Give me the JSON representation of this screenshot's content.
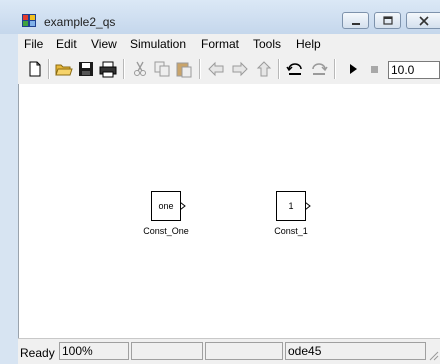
{
  "window": {
    "title": "example2_qs"
  },
  "menu": [
    "File",
    "Edit",
    "View",
    "Simulation",
    "Format",
    "Tools",
    "Help"
  ],
  "toolbar": {
    "stop_time": "10.0"
  },
  "blocks": [
    {
      "text": "one",
      "label": "Const_One"
    },
    {
      "text": "1",
      "label": "Const_1"
    }
  ],
  "status": {
    "ready": "Ready",
    "zoom": "100%",
    "field3": "",
    "field4": "",
    "solver": "ode45"
  }
}
